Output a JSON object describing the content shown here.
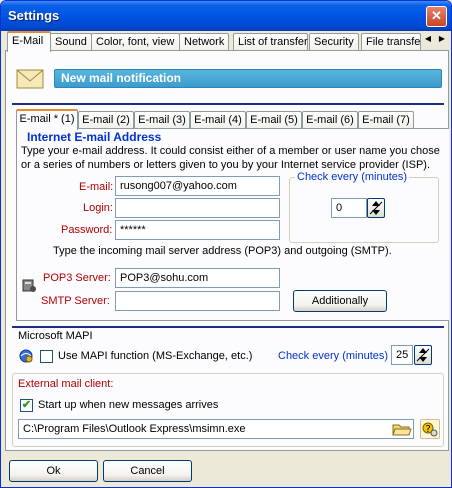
{
  "window": {
    "title": "Settings",
    "close_label": "✕"
  },
  "top_tabs": [
    {
      "label": "E-Mail"
    },
    {
      "label": "Sound"
    },
    {
      "label": "Color, font, view"
    },
    {
      "label": "Network"
    },
    {
      "label": "List of transfer"
    },
    {
      "label": "Security"
    },
    {
      "label": "File transfe"
    }
  ],
  "banner": {
    "text": "New mail notification"
  },
  "inner_tabs": [
    "E-mail * (1)",
    "E-mail (2)",
    "E-mail (3)",
    "E-mail (4)",
    "E-mail (5)",
    "E-mail (6)",
    "E-mail (7)"
  ],
  "internet_email": {
    "title": "Internet E-mail Address",
    "description_line1": "Type your e-mail address. It could consist either of a member or user name you chose",
    "description_line2": "or a series of numbers or letters given to you by your Internet service provider (ISP).",
    "email_label": "E-mail:",
    "email_value": "rusong007@yahoo.com",
    "login_label": "Login:",
    "login_value": "",
    "password_label": "Password:",
    "password_value": "******",
    "check_every_label": "Check every (minutes)",
    "check_every_value": "0",
    "server_instructions": "Type the incoming mail server address (POP3) and outgoing (SMTP).",
    "pop3_label": "POP3 Server:",
    "pop3_value": "POP3@sohu.com",
    "smtp_label": "SMTP Server:",
    "smtp_value": "",
    "additionally_label": "Additionally"
  },
  "mapi": {
    "title": "Microsoft MAPI",
    "use_label": "Use MAPI function (MS-Exchange, etc.)",
    "use_checked": false,
    "check_every_label": "Check every (minutes)",
    "check_every_value": "25"
  },
  "external": {
    "title": "External mail client:",
    "startup_label": "Start up when new messages arrives",
    "startup_checked": true,
    "path_value": "C:\\Program Files\\Outlook Express\\msimn.exe"
  },
  "footer": {
    "ok_label": "Ok",
    "cancel_label": "Cancel"
  },
  "colors": {
    "title_blue": "#0054e3",
    "label_red": "#b00000",
    "label_blue": "#0033cc",
    "banner": "#4aa8d6"
  }
}
